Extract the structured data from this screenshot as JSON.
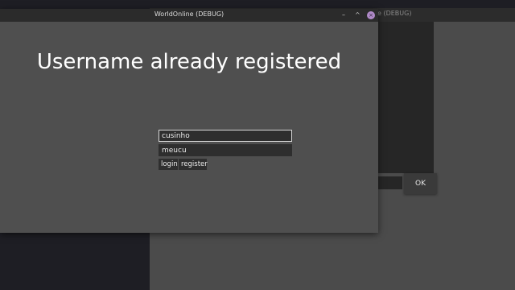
{
  "background_window": {
    "title": "e (DEBUG)",
    "ok_label": "OK"
  },
  "main_window": {
    "title": "WorldOnline (DEBUG)",
    "controls": {
      "minimize": "–",
      "maximize": "^",
      "close": "×"
    }
  },
  "login_form": {
    "heading": "Username already registered",
    "username_value": "cusinho",
    "password_value": "meucu",
    "login_label": "login",
    "register_label": "register"
  },
  "colors": {
    "desktop": "#1e1e24",
    "window_bg": "#4f4f4f",
    "titlebar": "#2b2b2b",
    "field_bg": "#2e2e2e",
    "close_button": "#b08ac8"
  }
}
